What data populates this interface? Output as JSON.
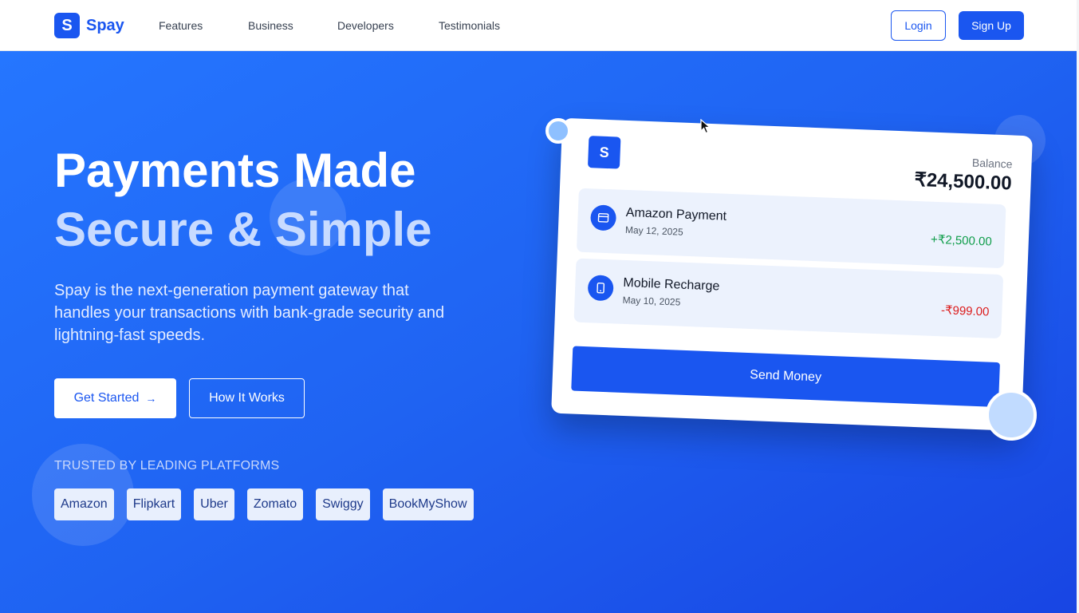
{
  "nav": {
    "logo_letter": "S",
    "brand": "Spay",
    "links": [
      "Features",
      "Business",
      "Developers",
      "Testimonials"
    ],
    "login": "Login",
    "signup": "Sign Up"
  },
  "hero": {
    "title_line1": "Payments Made",
    "title_line2": "Secure & Simple",
    "description": "Spay is the next-generation payment gateway that handles your transactions with bank-grade security and lightning-fast speeds.",
    "cta_primary": "Get Started",
    "cta_primary_icon": "→",
    "cta_secondary": "How It Works",
    "trusted_label": "TRUSTED BY LEADING PLATFORMS",
    "partners": [
      "Amazon",
      "Flipkart",
      "Uber",
      "Zomato",
      "Swiggy",
      "BookMyShow"
    ]
  },
  "card": {
    "logo_letter": "S",
    "balance_label": "Balance",
    "balance_amount": "₹24,500.00",
    "transactions": [
      {
        "name": "Amazon Payment",
        "date": "May 12, 2025",
        "amount": "+₹2,500.00",
        "icon": "credit-card-icon"
      },
      {
        "name": "Mobile Recharge",
        "date": "May 10, 2025",
        "amount": "-₹999.00",
        "icon": "mobile-phone-icon"
      }
    ],
    "send_button": "Send Money"
  },
  "colors": {
    "brand": "#1a56f0",
    "positive": "#0f9d4a",
    "negative": "#dc1d1d",
    "hero_gradient_start": "#2576ff",
    "hero_gradient_end": "#1845e3"
  }
}
